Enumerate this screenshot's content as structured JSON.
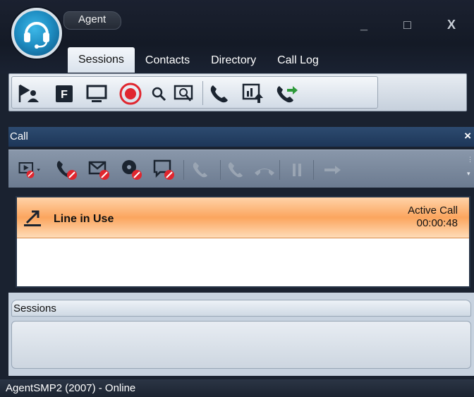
{
  "window": {
    "app_tab": "Agent",
    "controls": {
      "minimize": "_",
      "maximize": "□",
      "close": "X"
    }
  },
  "tabs": [
    {
      "label": "Sessions",
      "active": true
    },
    {
      "label": "Contacts",
      "active": false
    },
    {
      "label": "Directory",
      "active": false
    },
    {
      "label": "Call Log",
      "active": false
    }
  ],
  "ribbon": {
    "icons": [
      "agent-state-icon",
      "form-icon",
      "monitor-icon",
      "record-icon",
      "search-icon",
      "zoom-screen-icon",
      "phone-icon",
      "report-upload-icon",
      "transfer-call-icon"
    ]
  },
  "call_panel": {
    "title": "Call",
    "close": "×",
    "toolbar_icons": [
      "play-dropdown-icon",
      "end-call-icon",
      "end-email-icon",
      "end-session-icon",
      "end-chat-icon",
      "call-disabled-icon",
      "call-disabled-icon",
      "hangup-disabled-icon",
      "hold-disabled-icon",
      "transfer-disabled-icon"
    ],
    "line": {
      "label": "Line in Use",
      "status": "Active Call",
      "timer": "00:00:48"
    }
  },
  "sessions_panel": {
    "title": "Sessions"
  },
  "statusbar": {
    "text": "AgentSMP2 (2007)  - Online"
  },
  "colors": {
    "accent": "#1f8fc4",
    "active_call_orange": "#fba55e",
    "panel_header": "#2d4b70",
    "red": "#e0262e",
    "green": "#2e9a3a"
  }
}
